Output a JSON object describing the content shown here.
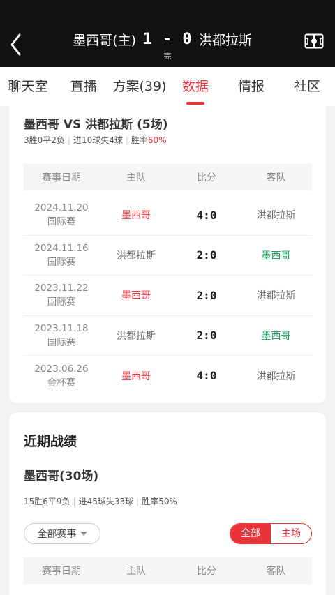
{
  "header": {
    "home_team": "墨西哥(主)",
    "score": "1 - 0",
    "away_team": "洪都拉斯",
    "status": "完"
  },
  "tabs": [
    {
      "label": "聊天室"
    },
    {
      "label": "直播"
    },
    {
      "label": "方案(39)"
    },
    {
      "label": "数据",
      "active": true
    },
    {
      "label": "情报"
    },
    {
      "label": "社区"
    }
  ],
  "h2h": {
    "title": "墨西哥 VS 洪都拉斯 (5场)",
    "record": "3胜0平2负",
    "goals": "进10球失4球",
    "win_rate_label": "胜率",
    "win_rate": "60%",
    "columns": [
      "赛事日期",
      "主队",
      "比分",
      "客队"
    ],
    "rows": [
      {
        "date": "2024.11.20",
        "comp": "国际赛",
        "home": "墨西哥",
        "score": "4:0",
        "away": "洪都拉斯",
        "winner": "home"
      },
      {
        "date": "2024.11.16",
        "comp": "国际赛",
        "home": "洪都拉斯",
        "score": "2:0",
        "away": "墨西哥",
        "winner": "away"
      },
      {
        "date": "2023.11.22",
        "comp": "国际赛",
        "home": "墨西哥",
        "score": "2:0",
        "away": "洪都拉斯",
        "winner": "home"
      },
      {
        "date": "2023.11.18",
        "comp": "国际赛",
        "home": "洪都拉斯",
        "score": "2:0",
        "away": "墨西哥",
        "winner": "away"
      },
      {
        "date": "2023.06.26",
        "comp": "金杯赛",
        "home": "墨西哥",
        "score": "4:0",
        "away": "洪都拉斯",
        "winner": "home"
      }
    ]
  },
  "recent": {
    "title": "近期战绩",
    "team_title": "墨西哥(30场)",
    "record": "15胜6平9负",
    "goals": "进45球失33球",
    "win_rate": "胜率50%",
    "filter_label": "全部赛事",
    "seg_all": "全部",
    "seg_home": "主场",
    "columns": [
      "赛事日期",
      "主队",
      "比分",
      "客队"
    ]
  },
  "colors": {
    "accent": "#e8333a",
    "win_green": "#1aa05a",
    "header_bg": "#121212"
  }
}
